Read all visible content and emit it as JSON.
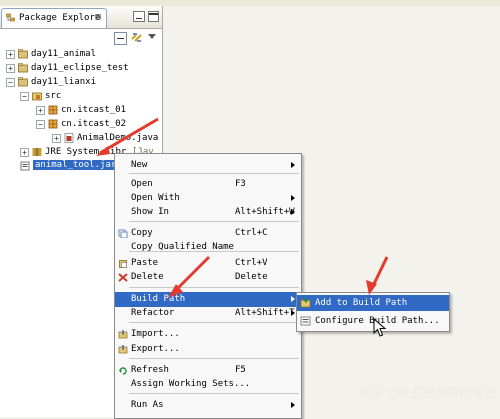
{
  "colors": {
    "selection": "#316ac5",
    "arrow": "#e23c2e",
    "package": "#c47a1b",
    "java": "#b33a2b"
  },
  "explorer": {
    "tab_label": "Package Explore",
    "tab_close": "⊠",
    "tree": [
      {
        "label": "day11_animal",
        "toggle": "+",
        "icon": "project-icon"
      },
      {
        "label": "day11_eclipse_test",
        "toggle": "+",
        "icon": "project-icon"
      },
      {
        "label": "day11_lianxi",
        "toggle": "−",
        "icon": "project-icon"
      },
      {
        "label": "src",
        "toggle": "−",
        "icon": "source-folder-icon"
      },
      {
        "label": "cn.itcast_01",
        "toggle": "+",
        "icon": "package-icon"
      },
      {
        "label": "cn.itcast_02",
        "toggle": "−",
        "icon": "package-icon"
      },
      {
        "label": "AnimalDemo.java",
        "toggle": "+",
        "icon": "java-file-icon"
      },
      {
        "label": "JRE System Libr",
        "toggle": "+",
        "icon": "library-icon",
        "suffix": "[Jav"
      },
      {
        "label": "animal_tool.jar",
        "toggle": "",
        "icon": "jar-icon",
        "selected": true
      }
    ]
  },
  "context_menu": {
    "items": [
      {
        "label": "New",
        "shortcut": "",
        "submenu": true
      },
      {
        "label": "Open",
        "shortcut": "F3",
        "submenu": false
      },
      {
        "label": "Open With",
        "shortcut": "",
        "submenu": true
      },
      {
        "label": "Show In",
        "shortcut": "Alt+Shift+W",
        "submenu": true
      },
      {
        "label": "Copy",
        "shortcut": "Ctrl+C",
        "submenu": false
      },
      {
        "label": "Copy Qualified Name",
        "shortcut": "",
        "submenu": false
      },
      {
        "label": "Paste",
        "shortcut": "Ctrl+V",
        "submenu": false
      },
      {
        "label": "Delete",
        "shortcut": "Delete",
        "submenu": false
      },
      {
        "label": "Build Path",
        "shortcut": "",
        "submenu": true,
        "selected": true
      },
      {
        "label": "Refactor",
        "shortcut": "Alt+Shift+T",
        "submenu": true
      },
      {
        "label": "Import...",
        "shortcut": "",
        "submenu": false
      },
      {
        "label": "Export...",
        "shortcut": "",
        "submenu": false
      },
      {
        "label": "Refresh",
        "shortcut": "F5",
        "submenu": false
      },
      {
        "label": "Assign Working Sets...",
        "shortcut": "",
        "submenu": false
      },
      {
        "label": "Run As",
        "shortcut": "",
        "submenu": true
      }
    ]
  },
  "submenu": {
    "items": [
      {
        "label": "Add to Build Path",
        "selected": true
      },
      {
        "label": "Configure Build Path...",
        "selected": false
      }
    ]
  },
  "watermark": "知乎 @扎犯是最好的语言"
}
